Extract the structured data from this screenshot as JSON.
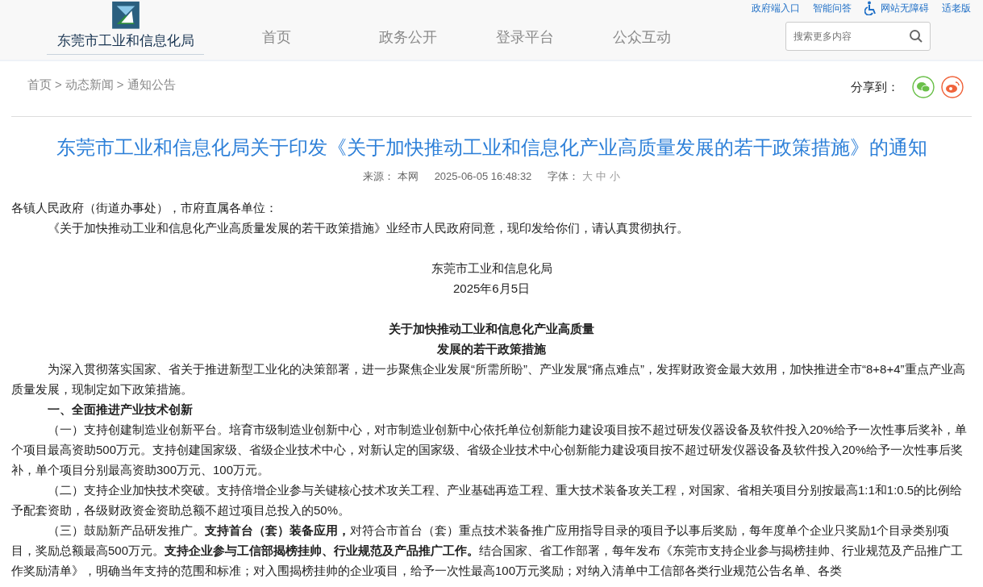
{
  "header": {
    "logo_text": "东莞市工业和信息化局",
    "nav": [
      "首页",
      "政务公开",
      "登录平台",
      "公众互动"
    ],
    "top_links": [
      {
        "label": "政府端入口",
        "kind": "text"
      },
      {
        "label": "智能问答",
        "kind": "text"
      },
      {
        "label": "网站无障碍",
        "kind": "accessible"
      },
      {
        "label": "适老版",
        "kind": "text"
      }
    ],
    "search": {
      "placeholder": "搜索更多内容"
    }
  },
  "breadcrumb": {
    "items": [
      "首页",
      "动态新闻",
      "通知公告"
    ],
    "separator": ">"
  },
  "share": {
    "label": "分享到："
  },
  "article": {
    "title": "东莞市工业和信息化局关于印发《关于加快推动工业和信息化产业高质量发展的若干政策措施》的通知",
    "meta": {
      "source_label": "来源：",
      "source": "本网",
      "date": "2025-06-05 16:48:32",
      "font_label": "字体：",
      "font_sizes": [
        "大",
        "中",
        "小"
      ]
    },
    "blocks": [
      {
        "kind": "plain",
        "text": "各镇人民政府（街道办事处），市府直属各单位："
      },
      {
        "kind": "indent",
        "text": "《关于加快推动工业和信息化产业高质量发展的若干政策措施》业经市人民政府同意，现印发给你们，请认真贯彻执行。"
      },
      {
        "kind": "gap"
      },
      {
        "kind": "center",
        "text": "东莞市工业和信息化局"
      },
      {
        "kind": "center",
        "text": "2025年6月5日"
      },
      {
        "kind": "gap"
      },
      {
        "kind": "heading",
        "text": "关于加快推动工业和信息化产业高质量"
      },
      {
        "kind": "heading",
        "text": "发展的若干政策措施"
      },
      {
        "kind": "indent",
        "text": "为深入贯彻落实国家、省关于推进新型工业化的决策部署，进一步聚焦企业发展“所需所盼”、产业发展“痛点难点”，发挥财政资金最大效用，加快推进全市“8+8+4”重点产业高质量发展，现制定如下政策措施。"
      },
      {
        "kind": "section",
        "text": "一、全面推进产业技术创新"
      },
      {
        "kind": "indent",
        "text": "（一）支持创建制造业创新平台。培育市级制造业创新中心，对市制造业创新中心依托单位创新能力建设项目按不超过研发仪器设备及软件投入20%给予一次性事后奖补，单个项目最高资助500万元。支持创建国家级、省级企业技术中心，对新认定的国家级、省级企业技术中心创新能力建设项目按不超过研发仪器设备及软件投入20%给予一次性事后奖补，单个项目分别最高资助300万元、100万元。"
      },
      {
        "kind": "indent",
        "text": "（二）支持企业加快技术突破。支持倍增企业参与关键核心技术攻关工程、产业基础再造工程、重大技术装备攻关工程，对国家、省相关项目分别按最高1:1和1:0.5的比例给予配套资助，各级财政资金资助总额不超过项目总投入的50%。"
      },
      {
        "kind": "indent",
        "text": "（三）鼓励新产品研发推广。**支持首台（套）装备应用，**对符合市首台（套）重点技术装备推广应用指导目录的项目予以事后奖励，每年度单个企业只奖励1个目录类别项目，奖励总额最高500万元。**支持企业参与工信部揭榜挂帅、行业规范及产品推广工作。**结合国家、省工作部署，每年发布《东莞市支持企业参与揭榜挂帅、行业规范及产品推广工作奖励清单》，明确当年支持的范围和标准；对入围揭榜挂帅的企业项目，给予一次性最高100万元奖励；对纳入清单中工信部各类行业规范公告名单、各类"
      }
    ]
  }
}
